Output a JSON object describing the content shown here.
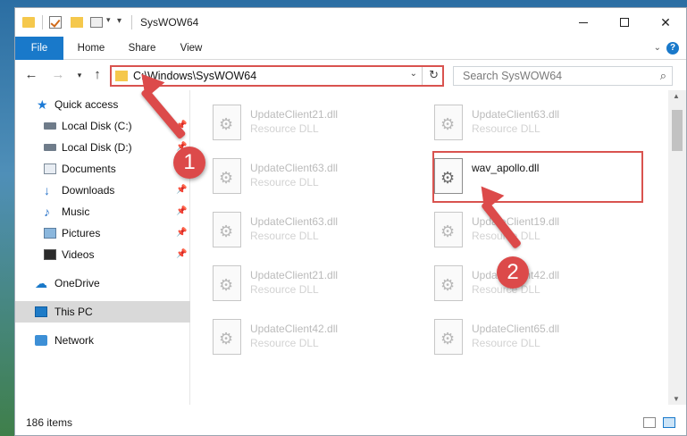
{
  "window": {
    "title": "SysWOW64",
    "controls": {
      "minimize": "—",
      "maximize": "☐",
      "close": "✕"
    }
  },
  "ribbon": {
    "tabs": [
      {
        "label": "File"
      },
      {
        "label": "Home"
      },
      {
        "label": "Share"
      },
      {
        "label": "View"
      }
    ],
    "help": "?"
  },
  "nav": {
    "address": "C:\\Windows\\SysWOW64",
    "search_placeholder": "Search SysWOW64"
  },
  "sidebar": {
    "items": [
      {
        "label": "Quick access",
        "icon": "star-icon",
        "pinned": false
      },
      {
        "label": "Local Disk (C:)",
        "icon": "drive-icon",
        "pinned": true
      },
      {
        "label": "Local Disk (D:)",
        "icon": "drive-icon",
        "pinned": true
      },
      {
        "label": "Documents",
        "icon": "documents-icon",
        "pinned": true
      },
      {
        "label": "Downloads",
        "icon": "download-icon",
        "pinned": true
      },
      {
        "label": "Music",
        "icon": "music-icon",
        "pinned": true
      },
      {
        "label": "Pictures",
        "icon": "pictures-icon",
        "pinned": true
      },
      {
        "label": "Videos",
        "icon": "videos-icon",
        "pinned": true
      },
      {
        "label": "OneDrive",
        "icon": "cloud-icon",
        "pinned": false
      },
      {
        "label": "This PC",
        "icon": "computer-icon",
        "pinned": false,
        "selected": true
      },
      {
        "label": "Network",
        "icon": "network-icon",
        "pinned": false
      }
    ]
  },
  "files": [
    {
      "name": "UpdateClient21.dll",
      "type": "Resource DLL"
    },
    {
      "name": "UpdateClient63.dll",
      "type": "Resource DLL"
    },
    {
      "name": "UpdateClient63.dll",
      "type": "Resource DLL"
    },
    {
      "name": "wav_apollo.dll",
      "type": "",
      "highlighted": true
    },
    {
      "name": "UpdateClient63.dll",
      "type": "Resource DLL"
    },
    {
      "name": "UpdateClient19.dll",
      "type": "Resource DLL"
    },
    {
      "name": "UpdateClient21.dll",
      "type": "Resource DLL"
    },
    {
      "name": "UpdateClient42.dll",
      "type": "Resource DLL"
    },
    {
      "name": "UpdateClient42.dll",
      "type": "Resource DLL"
    },
    {
      "name": "UpdateClient65.dll",
      "type": "Resource DLL"
    }
  ],
  "status": {
    "item_count": "186 items"
  },
  "annotations": {
    "step1": "1",
    "step2": "2",
    "color": "#dc4a4a"
  }
}
